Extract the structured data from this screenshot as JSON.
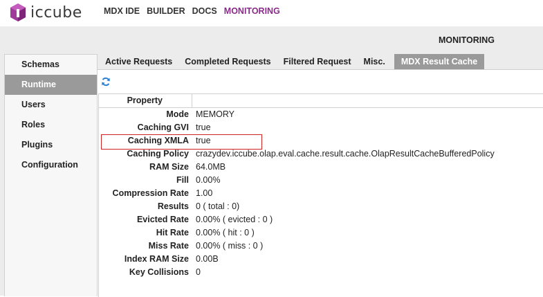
{
  "app": {
    "logo_text": "iccube",
    "brand_color": "#8a2a8a"
  },
  "topnav": {
    "items": [
      {
        "label": "MDX IDE"
      },
      {
        "label": "BUILDER"
      },
      {
        "label": "DOCS"
      },
      {
        "label": "MONITORING"
      }
    ],
    "active": "MONITORING"
  },
  "section_title": "MONITORING",
  "sidebar": {
    "items": [
      {
        "label": "Schemas"
      },
      {
        "label": "Runtime"
      },
      {
        "label": "Users"
      },
      {
        "label": "Roles"
      },
      {
        "label": "Plugins"
      },
      {
        "label": "Configuration"
      }
    ],
    "active": "Runtime"
  },
  "tabs": {
    "items": [
      {
        "label": "Active Requests"
      },
      {
        "label": "Completed Requests"
      },
      {
        "label": "Filtered Request"
      },
      {
        "label": "Misc."
      },
      {
        "label": "MDX Result Cache"
      }
    ],
    "active": "MDX Result Cache"
  },
  "toolbar": {
    "refresh_icon": "refresh-icon"
  },
  "table": {
    "header": "Property",
    "rows": [
      {
        "key": "Mode",
        "value": "MEMORY"
      },
      {
        "key": "Caching GVI",
        "value": "true"
      },
      {
        "key": "Caching XMLA",
        "value": "true"
      },
      {
        "key": "Caching Policy",
        "value": "crazydev.iccube.olap.eval.cache.result.cache.OlapResultCacheBufferedPolicy"
      },
      {
        "key": "RAM Size",
        "value": "64.0MB"
      },
      {
        "key": "Fill",
        "value": "0.00%"
      },
      {
        "key": "Compression Rate",
        "value": "1.00"
      },
      {
        "key": "Results",
        "value": "0 ( total : 0)"
      },
      {
        "key": "Evicted Rate",
        "value": "0.00% ( evicted : 0 )"
      },
      {
        "key": "Hit Rate",
        "value": "0.00% ( hit : 0 )"
      },
      {
        "key": "Miss Rate",
        "value": "0.00% ( miss : 0 )"
      },
      {
        "key": "Index RAM Size",
        "value": "0.00B"
      },
      {
        "key": "Key Collisions",
        "value": "0"
      }
    ],
    "highlight_color": "#cc2222"
  }
}
